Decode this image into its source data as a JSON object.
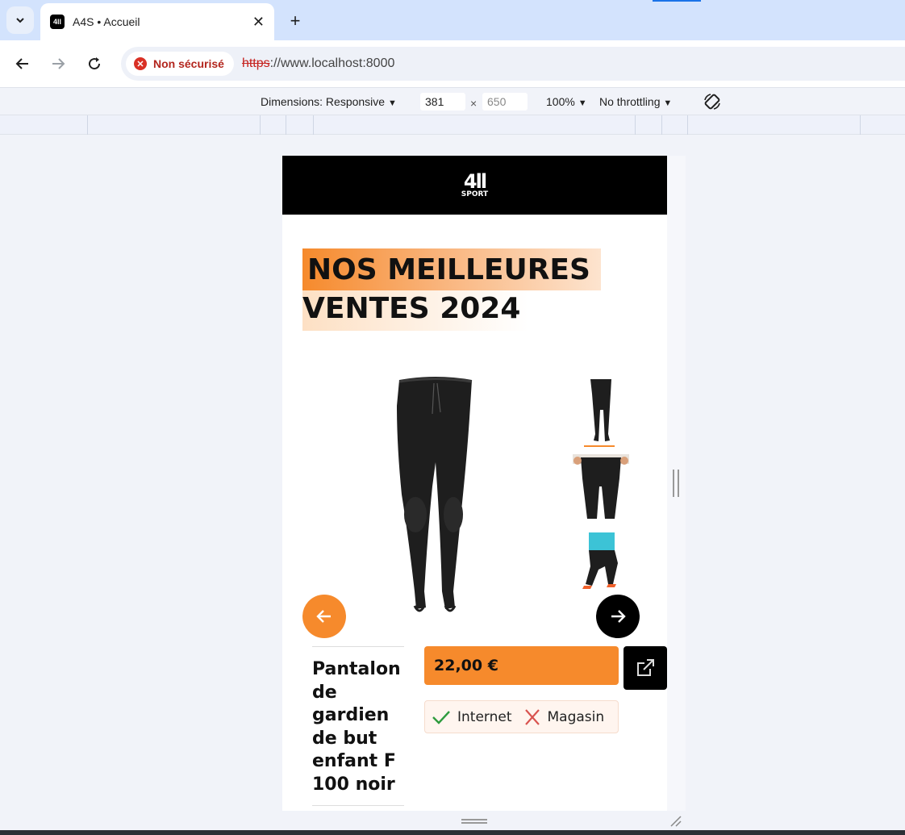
{
  "browser": {
    "tab_title": "A4S • Accueil",
    "tab_favicon_text": "4ll",
    "new_tab_symbol": "+",
    "close_symbol": "✕",
    "security_label": "Non sécurisé",
    "url_scheme": "https",
    "url_rest": "://www.localhost:8000"
  },
  "devtools": {
    "dimensions_label": "Dimensions: Responsive",
    "width_value": "381",
    "times": "×",
    "height_value": "650",
    "zoom": "100%",
    "throttling": "No throttling",
    "caret": "▼"
  },
  "site": {
    "logo_main": "4ll",
    "logo_sub": "SPORT",
    "heading_line1": "NOS MEILLEURES",
    "heading_line2": "VENTES 2024",
    "product": {
      "name": "Pantalon de gardien de but enfant F 100 noir",
      "price": "22,00 €",
      "availability": [
        {
          "label": "Internet",
          "available": true
        },
        {
          "label": "Magasin",
          "available": false
        }
      ]
    }
  },
  "colors": {
    "accent": "#f68a2c",
    "available": "#2e9b3e",
    "unavailable": "#d9534f"
  },
  "icons": [
    "chevron-down-icon",
    "back-arrow-icon",
    "forward-arrow-icon",
    "reload-icon",
    "insecure-icon",
    "rotate-icon",
    "arrow-left-icon",
    "arrow-right-icon",
    "external-link-icon",
    "check-icon",
    "cross-icon"
  ]
}
